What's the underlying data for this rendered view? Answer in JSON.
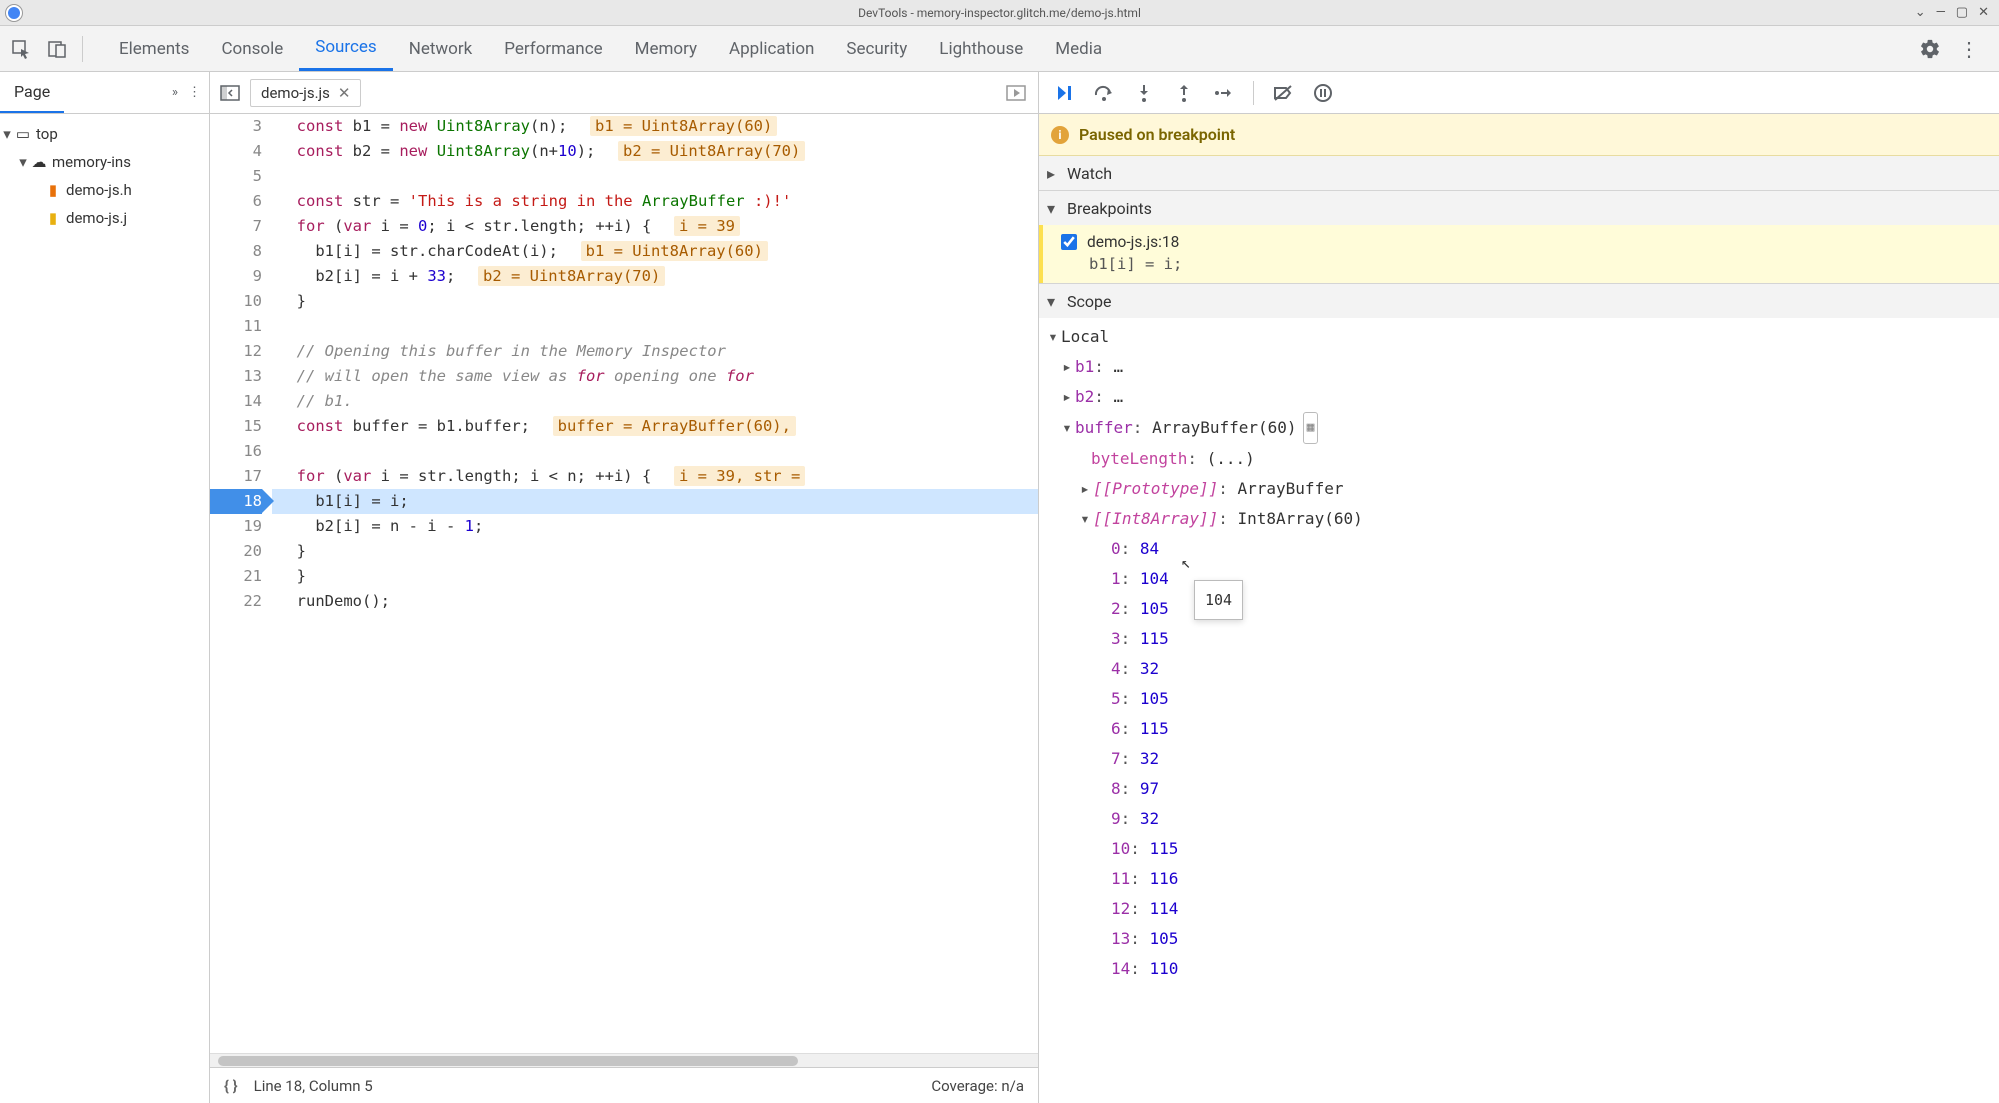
{
  "titlebar": {
    "title": "DevTools - memory-inspector.glitch.me/demo-js.html"
  },
  "maintabs": [
    "Elements",
    "Console",
    "Sources",
    "Network",
    "Performance",
    "Memory",
    "Application",
    "Security",
    "Lighthouse",
    "Media"
  ],
  "maintab_active": 2,
  "left": {
    "tab": "Page",
    "tree": {
      "top": "top",
      "domain": "memory-ins",
      "files": [
        "demo-js.html",
        "demo-js.js"
      ],
      "files_display": [
        "demo-js.h",
        "demo-js.j"
      ]
    }
  },
  "editor": {
    "filename": "demo-js.js",
    "first_line": 3,
    "exec_line": 18,
    "lines": [
      {
        "n": 3,
        "code": "const b1 = new Uint8Array(n);",
        "hint": "b1 = Uint8Array(60)"
      },
      {
        "n": 4,
        "code": "const b2 = new Uint8Array(n+10);",
        "hint": "b2 = Uint8Array(70)"
      },
      {
        "n": 5,
        "code": ""
      },
      {
        "n": 6,
        "code": "const str = 'This is a string in the ArrayBuffer :)!'"
      },
      {
        "n": 7,
        "code": "for (var i = 0; i < str.length; ++i) {",
        "hint": "i = 39"
      },
      {
        "n": 8,
        "code": "  b1[i] = str.charCodeAt(i);",
        "hint": "b1 = Uint8Array(60)"
      },
      {
        "n": 9,
        "code": "  b2[i] = i + 33;",
        "hint": "b2 = Uint8Array(70)"
      },
      {
        "n": 10,
        "code": "}"
      },
      {
        "n": 11,
        "code": ""
      },
      {
        "n": 12,
        "code": "// Opening this buffer in the Memory Inspector"
      },
      {
        "n": 13,
        "code": "// will open the same view as for opening one for"
      },
      {
        "n": 14,
        "code": "// b1."
      },
      {
        "n": 15,
        "code": "const buffer = b1.buffer;",
        "hint": "buffer = ArrayBuffer(60),"
      },
      {
        "n": 16,
        "code": ""
      },
      {
        "n": 17,
        "code": "for (var i = str.length; i < n; ++i) {",
        "hint": "i = 39, str ="
      },
      {
        "n": 18,
        "code": "  b1[i] = i;"
      },
      {
        "n": 19,
        "code": "  b2[i] = n - i - 1;"
      },
      {
        "n": 20,
        "code": "}"
      },
      {
        "n": 21,
        "code": "}"
      },
      {
        "n": 22,
        "code": "runDemo();"
      }
    ]
  },
  "status": {
    "pos": "Line 18, Column 5",
    "coverage": "Coverage: n/a"
  },
  "debugger": {
    "paused": "Paused on breakpoint",
    "sections": {
      "watch": "Watch",
      "breakpoints": "Breakpoints",
      "scope": "Scope"
    },
    "breakpoint": {
      "file": "demo-js.js:18",
      "code": "b1[i] = i;"
    },
    "scope_local": "Local",
    "vars": {
      "b1": "…",
      "b2": "…",
      "buffer": "ArrayBuffer(60)",
      "byteLength": "(...)",
      "prototype": "ArrayBuffer",
      "int8array": "Int8Array(60)"
    },
    "array_values": [
      84,
      104,
      105,
      115,
      32,
      105,
      115,
      32,
      97,
      32,
      115,
      116,
      114,
      105,
      110
    ],
    "tooltip": "104"
  }
}
